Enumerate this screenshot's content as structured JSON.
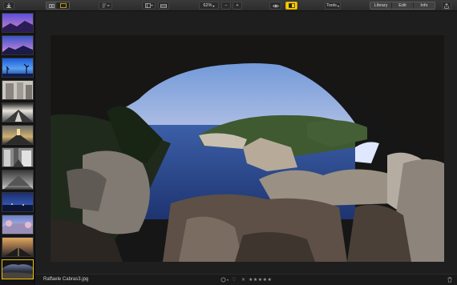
{
  "toolbar": {
    "import_icon": "download-icon",
    "view_icon": "viewer-icon",
    "sort_icon": "sort-icon",
    "compare_icon": "compare-icon",
    "zoom_value": "62%",
    "zoom_minus": "−",
    "zoom_plus": "+",
    "eye_icon": "eye-icon",
    "tools_label": "Tools",
    "library_label": "Library",
    "edit_label": "Edit",
    "info_label": "Info",
    "share_icon": "share-icon",
    "accent": "#ffcc00"
  },
  "status": {
    "filename": "Raffaele Cabras3.jpg",
    "rating_stars": "★★★★★",
    "reject_mark": "✕",
    "heart": "♡"
  }
}
